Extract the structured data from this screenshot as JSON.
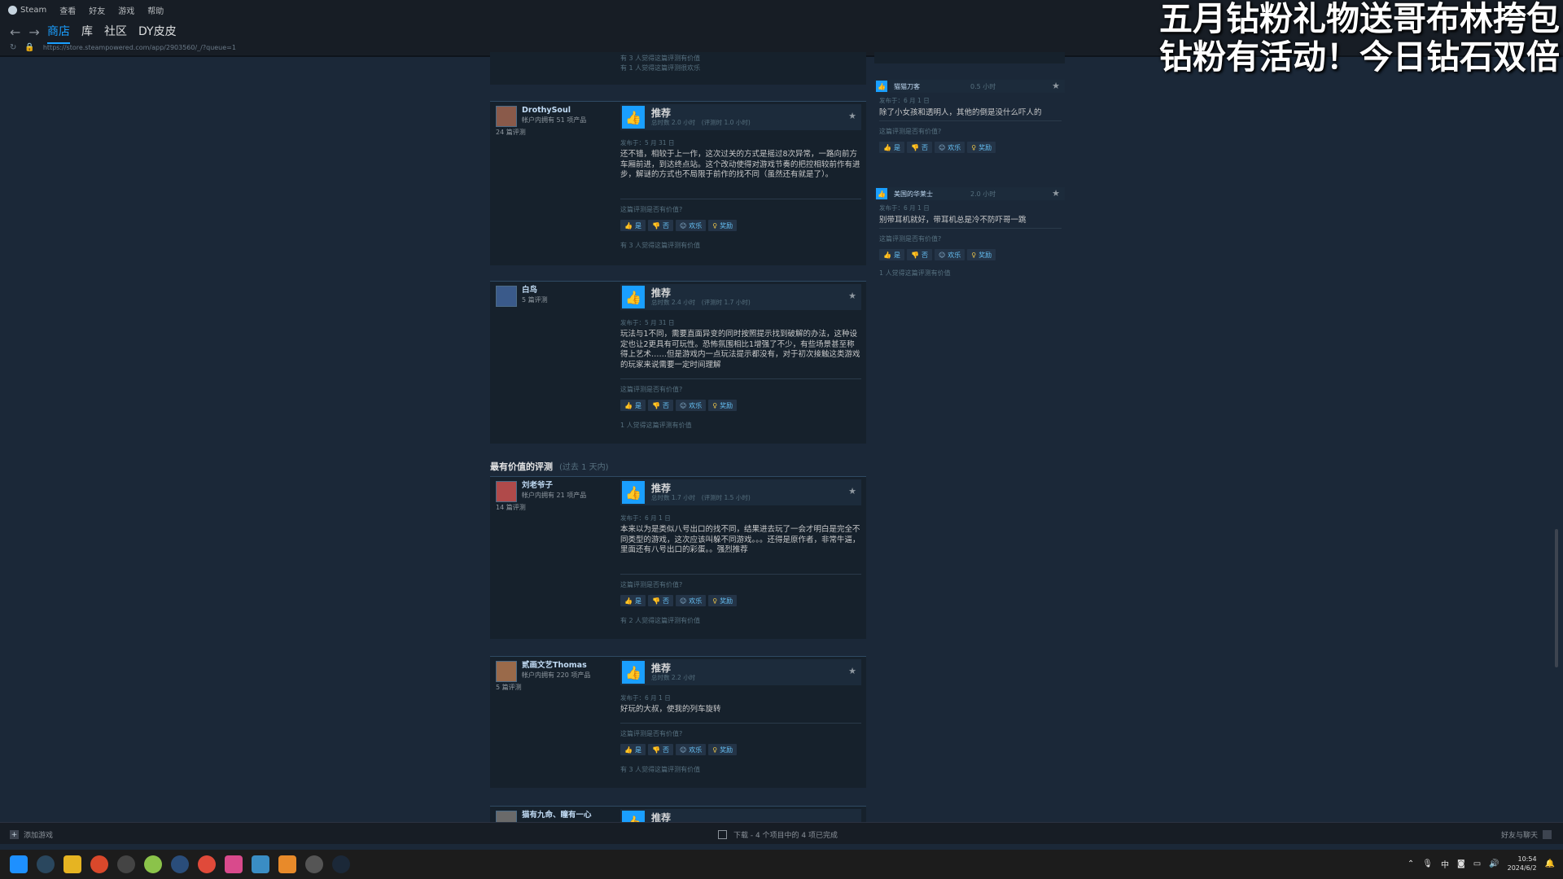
{
  "menubar": {
    "app": "Steam",
    "items": [
      "查看",
      "好友",
      "游戏",
      "帮助"
    ]
  },
  "nav": {
    "back": "←",
    "forward": "→",
    "tabs": [
      {
        "label": "商店"
      },
      {
        "label": "库"
      },
      {
        "label": "社区"
      },
      {
        "label": "DY皮皮"
      }
    ],
    "url": "https://store.steampowered.com/app/2903560/_/?queue=1"
  },
  "overlay": {
    "line1": "五月钻粉礼物送哥布林挎包",
    "line2": "钻粉有活动！今日钻石双倍"
  },
  "top_fragment": {
    "line1": "有 3 人觉得这篇评测有价值",
    "line2": "有 1 人觉得这篇评测很欢乐"
  },
  "vote_labels": {
    "question": "这篇评测是否有价值?",
    "yes": "是",
    "no": "否",
    "funny": "欢乐",
    "award": "奖励"
  },
  "reviews": [
    {
      "name": "DrothySoul",
      "owned": "帐户内拥有 51 项产品",
      "count": "24 篇评测",
      "verdict": "推荐",
      "hours": "总时数 2.0 小时　(评测时 1.0 小时)",
      "posted": "发布于：5 月 31 日",
      "text": "还不错，相较于上一作，这次过关的方式是摇过8次异常，一路向前方车厢前进，到达终点站。这个改动使得对游戏节奏的把控相较前作有进步，解谜的方式也不局限于前作的找不同（虽然还有就是了）。",
      "helpful": "有 3 人觉得这篇评测有价值"
    },
    {
      "name": "白鸟",
      "owned": "",
      "count": "5 篇评测",
      "verdict": "推荐",
      "hours": "总时数 2.4 小时　(评测时 1.7 小时)",
      "posted": "发布于：5 月 31 日",
      "text": "玩法与1不同，需要直面异变的同时按照提示找到破解的办法，这种设定也让2更具有可玩性。恐怖氛围相比1增强了不少，有些场景甚至称得上艺术……但是游戏内一点玩法提示都没有，对于初次接触这类游戏的玩家来说需要一定时间理解",
      "helpful": "1 人觉得这篇评测有价值"
    },
    {
      "name": "刘老爷子",
      "owned": "帐户内拥有 21 项产品",
      "count": "14 篇评测",
      "verdict": "推荐",
      "hours": "总时数 1.7 小时　(评测时 1.5 小时)",
      "posted": "发布于：6 月 1 日",
      "text": "本来以为是类似八号出口的找不同，结果进去玩了一会才明白是完全不同类型的游戏，这次应该叫躲不同游戏。。。还得是原作者，非常牛逼，里面还有八号出口的彩蛋。。强烈推荐",
      "helpful": "有 2 人觉得这篇评测有价值"
    },
    {
      "name": "贰画文艺Thomas",
      "owned": "帐户内拥有 220 项产品",
      "count": "5 篇评测",
      "verdict": "推荐",
      "hours": "总时数 2.2 小时",
      "posted": "发布于：6 月 1 日",
      "text": "好玩的大叔，使我的列车旋转",
      "helpful": "有 3 人觉得这篇评测有价值"
    },
    {
      "name": "猫有九命、瞳有一心",
      "verdict": "推荐"
    }
  ],
  "section": {
    "title": "最有价值的评测",
    "period": "(过去 1 天内)"
  },
  "side_reviews": [
    {
      "name": "猫猫刀客",
      "hours": "0.5 小时",
      "posted": "发布于：6 月 1 日",
      "text": "除了小女孩和透明人，其他的倒是没什么吓人的",
      "helpful": ""
    },
    {
      "name": "美国的华莱士",
      "hours": "2.0 小时",
      "posted": "发布于：6 月 1 日",
      "text": "别带耳机就好，带耳机总是冷不防吓哥一跳",
      "helpful": "1 人觉得这篇评测有价值"
    }
  ],
  "status": {
    "add_game": "添加游戏",
    "download": "下载 - 4 个项目中的 4 项已完成",
    "friends": "好友与聊天"
  },
  "taskbar": {
    "ime": "中",
    "time": "10:54",
    "date": "2024/6/2"
  }
}
